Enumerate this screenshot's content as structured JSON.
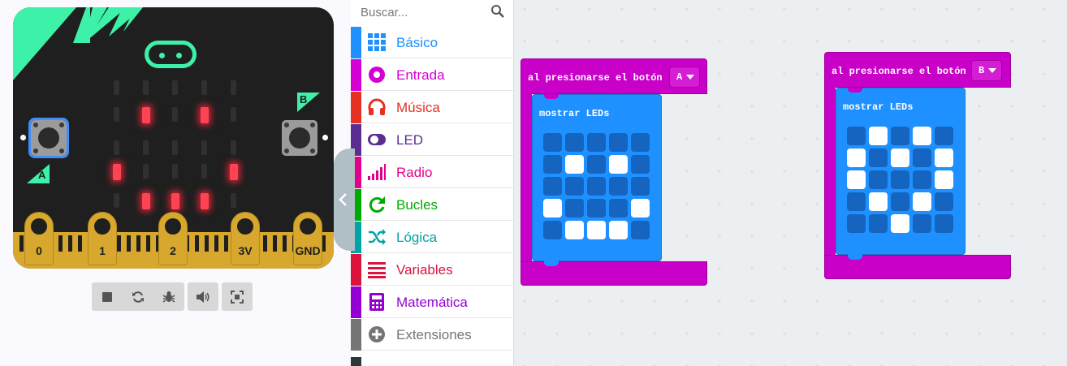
{
  "simulator": {
    "button_a_label": "A",
    "button_b_label": "B",
    "pins": [
      "0",
      "1",
      "2",
      "3V",
      "GND"
    ],
    "led_matrix": [
      [
        0,
        0,
        0,
        0,
        0
      ],
      [
        0,
        1,
        0,
        1,
        0
      ],
      [
        0,
        0,
        0,
        0,
        0
      ],
      [
        1,
        0,
        0,
        0,
        1
      ],
      [
        0,
        1,
        1,
        1,
        0
      ]
    ],
    "toolbar": [
      "stop-icon",
      "restart-icon",
      "debug-icon",
      "mute-icon",
      "fullscreen-icon"
    ]
  },
  "toolbox": {
    "search_placeholder": "Buscar...",
    "categories": [
      {
        "label": "Básico",
        "color": "#1e90ff",
        "icon": "grid-icon"
      },
      {
        "label": "Entrada",
        "color": "#d400d4",
        "icon": "radio-button-icon"
      },
      {
        "label": "Música",
        "color": "#e63022",
        "icon": "headphones-icon"
      },
      {
        "label": "LED",
        "color": "#5c2d91",
        "icon": "toggle-icon"
      },
      {
        "label": "Radio",
        "color": "#e3008c",
        "icon": "signal-bars-icon"
      },
      {
        "label": "Bucles",
        "color": "#00aa00",
        "icon": "refresh-icon"
      },
      {
        "label": "Lógica",
        "color": "#00a4a6",
        "icon": "shuffle-icon"
      },
      {
        "label": "Variables",
        "color": "#dc143c",
        "icon": "list-icon"
      },
      {
        "label": "Matemática",
        "color": "#9400d3",
        "icon": "calculator-icon"
      },
      {
        "label": "Extensiones",
        "color": "#757575",
        "icon": "plus-circle-icon"
      }
    ]
  },
  "workspace": {
    "blocks": [
      {
        "event_label": "al presionarse el botón",
        "button_value": "A",
        "inner_label": "mostrar LEDs",
        "leds": [
          [
            0,
            0,
            0,
            0,
            0
          ],
          [
            0,
            1,
            0,
            1,
            0
          ],
          [
            0,
            0,
            0,
            0,
            0
          ],
          [
            1,
            0,
            0,
            0,
            1
          ],
          [
            0,
            1,
            1,
            1,
            0
          ]
        ]
      },
      {
        "event_label": "al presionarse el botón",
        "button_value": "B",
        "inner_label": "mostrar LEDs",
        "leds": [
          [
            0,
            1,
            0,
            1,
            0
          ],
          [
            1,
            0,
            1,
            0,
            1
          ],
          [
            1,
            0,
            0,
            0,
            1
          ],
          [
            0,
            1,
            0,
            1,
            0
          ],
          [
            0,
            0,
            1,
            0,
            0
          ]
        ]
      }
    ]
  }
}
